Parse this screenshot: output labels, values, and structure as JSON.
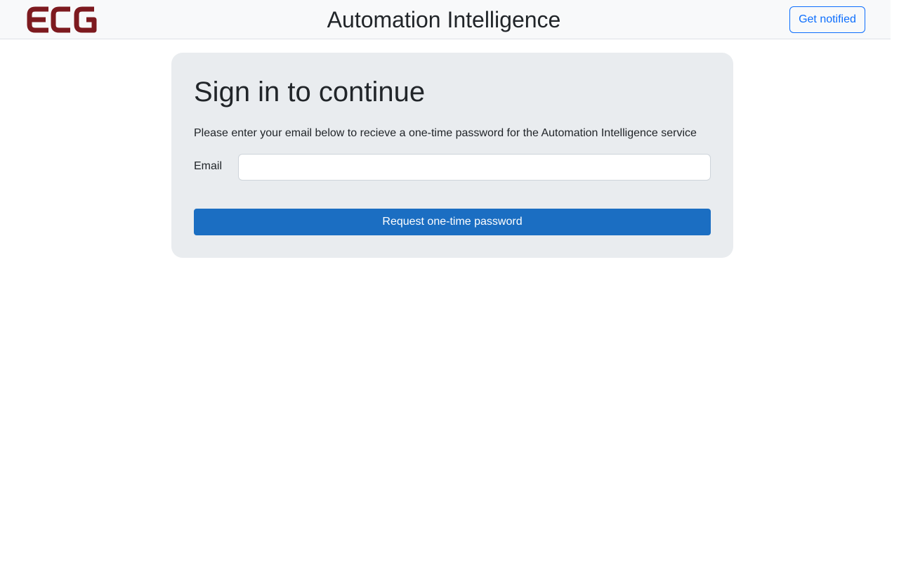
{
  "header": {
    "logo_text": "ECG",
    "logo_color": "#7d1a1f",
    "title": "Automation Intelligence",
    "notify_label": "Get notified"
  },
  "signin": {
    "heading": "Sign in to continue",
    "description": "Please enter your email below to recieve a one-time password for the Automation Intelligence service",
    "email_label": "Email",
    "email_value": "",
    "email_placeholder": "",
    "submit_label": "Request one-time password"
  },
  "colors": {
    "accent": "#0d6efd",
    "primary_button": "#1b6ec2",
    "card_background": "#e9ecef",
    "navbar_background": "#f8f9fa"
  }
}
